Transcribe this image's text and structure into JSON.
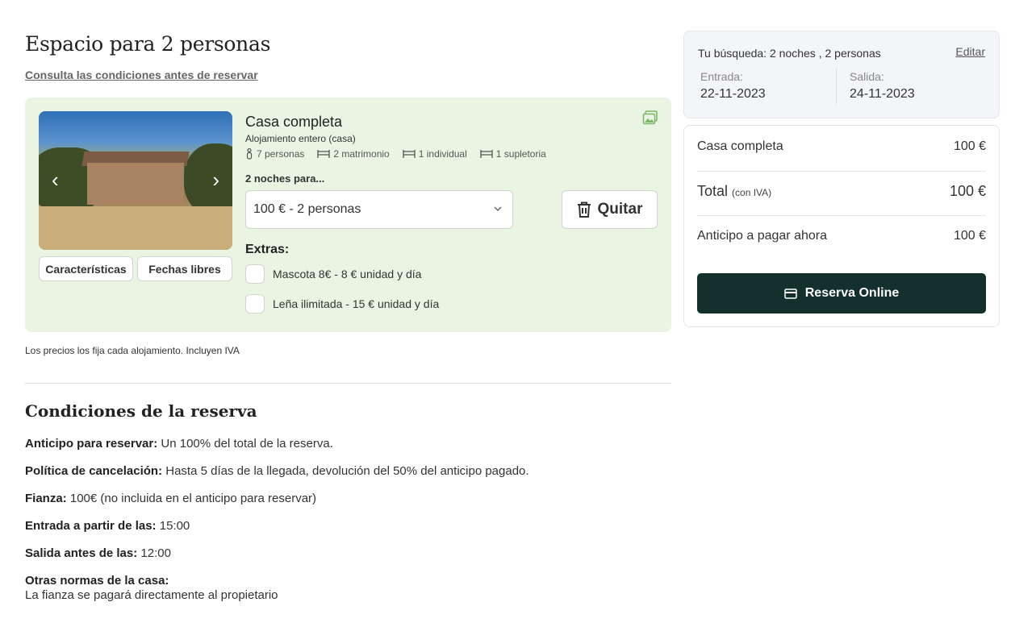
{
  "page": {
    "title": "Espacio para 2 personas",
    "conditions_link": "Consulta las condiciones antes de reservar"
  },
  "room": {
    "name": "Casa completa",
    "type": "Alojamiento entero (casa)",
    "features": {
      "people": "7 personas",
      "double": "2 matrimonio",
      "single": "1 individual",
      "extra": "1 supletoria"
    },
    "photo_buttons": {
      "characteristics": "Características",
      "free_dates": "Fechas libres"
    },
    "nights_label": "2 noches para...",
    "rate_select": "100 € - 2 personas",
    "remove_label": "Quitar",
    "extras_title": "Extras:",
    "extras": [
      {
        "label": "Mascota 8€ - 8 € unidad y día",
        "checked": false
      },
      {
        "label": "Leña ilimitada - 15 € unidad y día",
        "checked": false
      }
    ]
  },
  "prices_note": "Los precios los fija cada alojamiento. Incluyen IVA",
  "conditions": {
    "title": "Condiciones de la reserva",
    "deposit": {
      "label": "Anticipo para reservar:",
      "value": "Un 100% del total de la reserva."
    },
    "cancellation": {
      "label": "Política de cancelación:",
      "value": "Hasta 5 días de la llegada, devolución del 50% del anticipo pagado."
    },
    "bond": {
      "label": "Fianza:",
      "value": "100€ (no incluida en el anticipo para reservar)"
    },
    "checkin": {
      "label": "Entrada a partir de las:",
      "value": "15:00"
    },
    "checkout": {
      "label": "Salida antes de las:",
      "value": "12:00"
    },
    "other": {
      "label": "Otras normas de la casa:",
      "value": "La fianza se pagará directamente al propietario"
    }
  },
  "search": {
    "summary": "Tu búsqueda: 2 noches , 2 personas",
    "edit": "Editar",
    "checkin_label": "Entrada:",
    "checkin_date": "22-11-2023",
    "checkout_label": "Salida:",
    "checkout_date": "24-11-2023"
  },
  "summary": {
    "item_label": "Casa completa",
    "item_price": "100 €",
    "total_label": "Total",
    "total_note": "(con IVA)",
    "total_price": "100 €",
    "deposit_label": "Anticipo a pagar ahora",
    "deposit_price": "100 €",
    "reserve_button": "Reserva Online"
  },
  "colors": {
    "card_bg": "#e9f5e2",
    "primary_button": "#13302d",
    "search_bg": "#f3f5f8"
  }
}
